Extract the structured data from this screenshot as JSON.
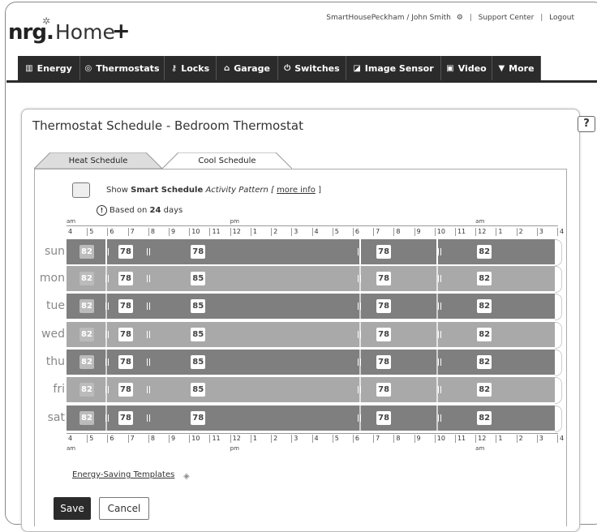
{
  "header": {
    "account": "SmartHousePeckham / John Smith",
    "support": "Support Center",
    "logout": "Logout",
    "logo_nrg": "nrg.",
    "logo_home": "Home",
    "logo_plus": "+"
  },
  "nav": {
    "tabs": [
      {
        "label": "Energy",
        "icon": "bar-chart-icon"
      },
      {
        "label": "Thermostats",
        "icon": "thermostat-icon"
      },
      {
        "label": "Locks",
        "icon": "key-icon"
      },
      {
        "label": "Garage",
        "icon": "garage-icon"
      },
      {
        "label": "Switches",
        "icon": "power-icon"
      },
      {
        "label": "Image Sensor",
        "icon": "camera-icon"
      },
      {
        "label": "Video",
        "icon": "play-icon"
      },
      {
        "label": "More",
        "icon": "triangle-down-icon"
      }
    ]
  },
  "page": {
    "title": "Thermostat Schedule - Bedroom Thermostat",
    "help": "?"
  },
  "schedule_tabs": {
    "heat": "Heat Schedule",
    "cool": "Cool Schedule",
    "active": "cool"
  },
  "smart": {
    "show": "Show ",
    "smart_schedule": "Smart Schedule",
    "activity": " Activity Pattern [ ",
    "more_info": "more info",
    "close": " ]",
    "based_pre": "Based on ",
    "based_days": "24",
    "based_post": " days"
  },
  "timeline": {
    "top_am": "am",
    "top_pm": "pm",
    "top_am2": "am",
    "hours": [
      "4",
      "5",
      "6",
      "7",
      "8",
      "9",
      "10",
      "11",
      "12",
      "1",
      "2",
      "3",
      "4",
      "5",
      "6",
      "7",
      "8",
      "9",
      "10",
      "11",
      "12",
      "1",
      "2",
      "3",
      "4"
    ]
  },
  "days": [
    {
      "label": "sun",
      "temps": [
        "82",
        "78",
        "78",
        "78",
        "82"
      ]
    },
    {
      "label": "mon",
      "temps": [
        "82",
        "78",
        "85",
        "78",
        "82"
      ]
    },
    {
      "label": "tue",
      "temps": [
        "82",
        "78",
        "85",
        "78",
        "82"
      ]
    },
    {
      "label": "wed",
      "temps": [
        "82",
        "78",
        "85",
        "78",
        "82"
      ]
    },
    {
      "label": "thu",
      "temps": [
        "82",
        "78",
        "85",
        "78",
        "82"
      ]
    },
    {
      "label": "fri",
      "temps": [
        "82",
        "78",
        "85",
        "78",
        "82"
      ]
    },
    {
      "label": "sat",
      "temps": [
        "82",
        "78",
        "78",
        "78",
        "82"
      ]
    }
  ],
  "footer": {
    "templates": "Energy-Saving Templates",
    "save": "Save",
    "cancel": "Cancel"
  },
  "colors": {
    "dark_row": "#7f7f7f",
    "light_row": "#a9a9a9",
    "nav_bg": "#2b2b2b"
  }
}
